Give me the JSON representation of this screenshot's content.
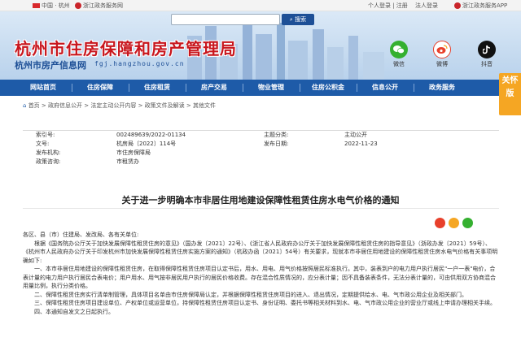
{
  "topbar": {
    "region": "中国 · 杭州",
    "portal": "浙江政务服务网",
    "user_links": "个人登录 | 注册",
    "corp_login": "法人登录",
    "mobile": "浙江政务服务APP"
  },
  "header": {
    "title": "杭州市住房保障和房产管理局",
    "subtitle": "杭州市房产信息网",
    "url": "fgj.hangzhou.gov.cn",
    "search_button": "搜索",
    "social": [
      {
        "label": "微信",
        "icon": "wechat-icon",
        "color": "#35b030"
      },
      {
        "label": "微博",
        "icon": "weibo-icon",
        "color": "#e8402b"
      },
      {
        "label": "抖音",
        "icon": "douyin-icon",
        "color": "#111111"
      }
    ]
  },
  "nav": {
    "items": [
      "网站首页",
      "住房保障",
      "住房租赁",
      "房产交易",
      "物业管理",
      "住房公积金",
      "信息公开",
      "政务服务"
    ]
  },
  "care_mode": "关怀版",
  "breadcrumb": {
    "home_icon": "home-icon",
    "items": [
      "首页",
      "政府信息公开",
      "法定主动公开内容",
      "政策文件及解读",
      "其他文件"
    ]
  },
  "meta": {
    "rows": [
      {
        "k1": "索引号:",
        "v1": "002489639/2022-01134",
        "k2": "主题分类:",
        "v2": "主动公开"
      },
      {
        "k1": "文号:",
        "v1": "杭房局〔2022〕114号",
        "k2": "发布日期:",
        "v2": "2022-11-23"
      },
      {
        "k1": "发布机构:",
        "v1": "市住房保障局",
        "k2": "",
        "v2": ""
      },
      {
        "k1": "政策咨询:",
        "v1": "市租赁办",
        "k2": "",
        "v2": ""
      }
    ]
  },
  "doc": {
    "title": "关于进一步明确本市非居住用地建设保障性租赁住房水电气价格的通知",
    "addressee": "各区、县（市）住建局、发改局、各有关单位:",
    "paragraphs": [
      "根据《国务院办公厅关于加快发展保障性租赁住房的意见》（国办发〔2021〕22号）、《浙江省人民政府办公厅关于加快发展保障性租赁住房的指导意见》（浙政办发〔2021〕59号）、《杭州市人民政府办公厅关于印发杭州市加快发展保障性租赁住房实施方案的通知》（杭政办函〔2021〕54号）有关要求，现就本市非居住用地建设的保障性租赁住房水电气价格有关事项明确如下:",
      "一、本市非居住用地建设的保障性租赁住房，在取得保障性租赁住房项目认定书后，用水、用电、用气价格按照居民标准执行。其中，装表到户的电力用户执行居民\"一户一表\"电价，合表计量的电力用户执行居民合表电价；用户用水、用气按非居民用户执行的居民价格收费。存在混合性质情况的，应分表计量；因不具备装表条件，无法分表计量的，可由供用双方协商混合用量比例，执行分类价格。",
      "二、保障性租赁住房实行清单制管理，具体项目名单由市住房保障局认定，并根据保障性租赁住房项目的进入、退出情况，定期提供给水、电、气市政公用企业及相关部门。",
      "三、保障性租赁住房项目建设单位、产权单位或运营单位，持保障性租赁住房项目认定书、身份证明、委托书等相关材料到水、电、气市政公用企业的营业厅或线上申请办理相关手续。",
      "四、本通知自发文之日起执行。"
    ]
  },
  "share": [
    {
      "icon": "weibo-share-icon",
      "color": "#e8402b"
    },
    {
      "icon": "qzone-share-icon",
      "color": "#f5a623"
    },
    {
      "icon": "wechat-share-icon",
      "color": "#35b030"
    }
  ]
}
